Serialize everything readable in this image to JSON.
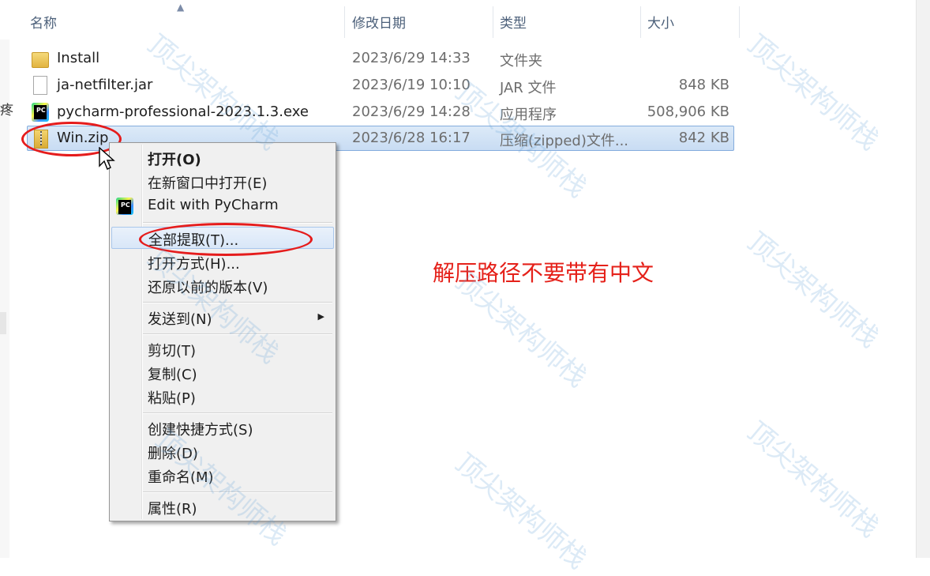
{
  "columns": {
    "name": "名称",
    "modified": "修改日期",
    "type": "类型",
    "size": "大小"
  },
  "sort_indicator": "▲",
  "left_fragment": "疼",
  "files": [
    {
      "name": "Install",
      "date": "2023/6/29 14:33",
      "type": "文件夹",
      "size": "",
      "icon": "folder-icon"
    },
    {
      "name": "ja-netfilter.jar",
      "date": "2023/6/19 10:10",
      "type": "JAR 文件",
      "size": "848 KB",
      "icon": "file-icon"
    },
    {
      "name": "pycharm-professional-2023.1.3.exe",
      "date": "2023/6/29 14:28",
      "type": "应用程序",
      "size": "508,906 KB",
      "icon": "pycharm-icon"
    },
    {
      "name": "Win.zip",
      "date": "2023/6/28 16:17",
      "type": "压缩(zipped)文件...",
      "size": "842 KB",
      "icon": "zip-icon",
      "selected": true
    }
  ],
  "context_menu": {
    "open": "打开(O)",
    "open_new_window": "在新窗口中打开(E)",
    "edit_pycharm": "Edit with PyCharm",
    "extract_all": "全部提取(T)...",
    "open_with": "打开方式(H)...",
    "restore": "还原以前的版本(V)",
    "send_to": "发送到(N)",
    "cut": "剪切(T)",
    "copy": "复制(C)",
    "paste": "粘贴(P)",
    "create_shortcut": "创建快捷方式(S)",
    "delete": "删除(D)",
    "rename": "重命名(M)",
    "properties": "属性(R)",
    "submenu_arrow": "▶",
    "pycharm_badge": "PC"
  },
  "annotation": "解压路径不要带有中文",
  "watermark": "顶尖架构师栈",
  "colors": {
    "annotation_red": "#e5211a",
    "selection_blue": "#c8dcf3",
    "watermark_blue": "#5fa0d7"
  }
}
